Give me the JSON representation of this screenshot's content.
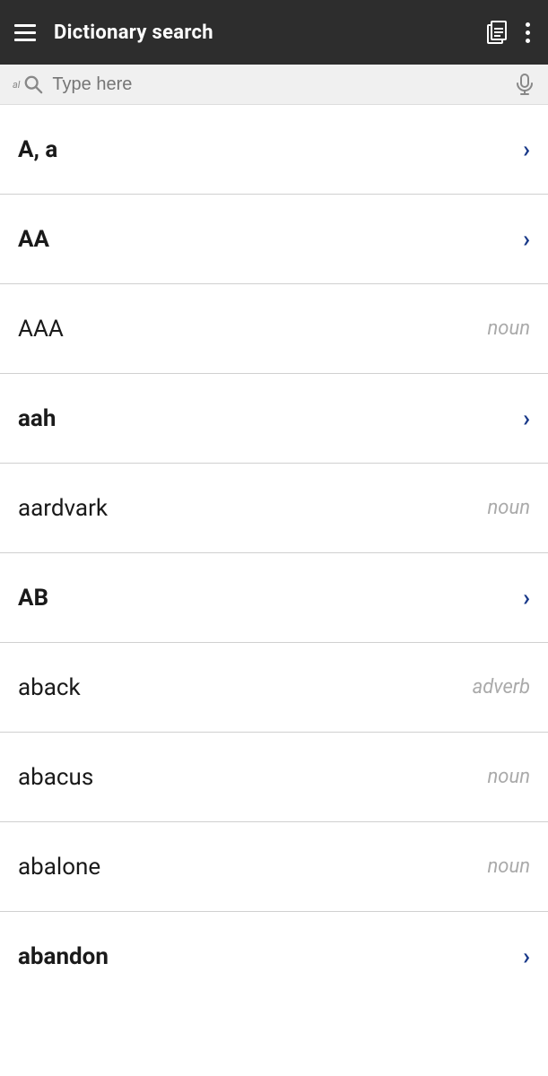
{
  "header": {
    "title": "Dictionary search",
    "menu_label": "menu",
    "copy_label": "copy",
    "more_label": "more options"
  },
  "search": {
    "placeholder": "Type here",
    "prefix": "al",
    "mic_label": "microphone"
  },
  "entries": [
    {
      "word": "A, a",
      "pos": null,
      "bold": true,
      "has_arrow": true
    },
    {
      "word": "AA",
      "pos": null,
      "bold": true,
      "has_arrow": true
    },
    {
      "word": "AAA",
      "pos": "noun",
      "bold": false,
      "has_arrow": false
    },
    {
      "word": "aah",
      "pos": null,
      "bold": true,
      "has_arrow": true
    },
    {
      "word": "aardvark",
      "pos": "noun",
      "bold": false,
      "has_arrow": false
    },
    {
      "word": "AB",
      "pos": null,
      "bold": true,
      "has_arrow": true
    },
    {
      "word": "aback",
      "pos": "adverb",
      "bold": false,
      "has_arrow": false
    },
    {
      "word": "abacus",
      "pos": "noun",
      "bold": false,
      "has_arrow": false
    },
    {
      "word": "abalone",
      "pos": "noun",
      "bold": false,
      "has_arrow": false
    },
    {
      "word": "abandon",
      "pos": null,
      "bold": true,
      "has_arrow": true
    }
  ],
  "colors": {
    "header_bg": "#2d2d2d",
    "chevron_color": "#1a3a8a",
    "pos_color": "#aaa"
  }
}
